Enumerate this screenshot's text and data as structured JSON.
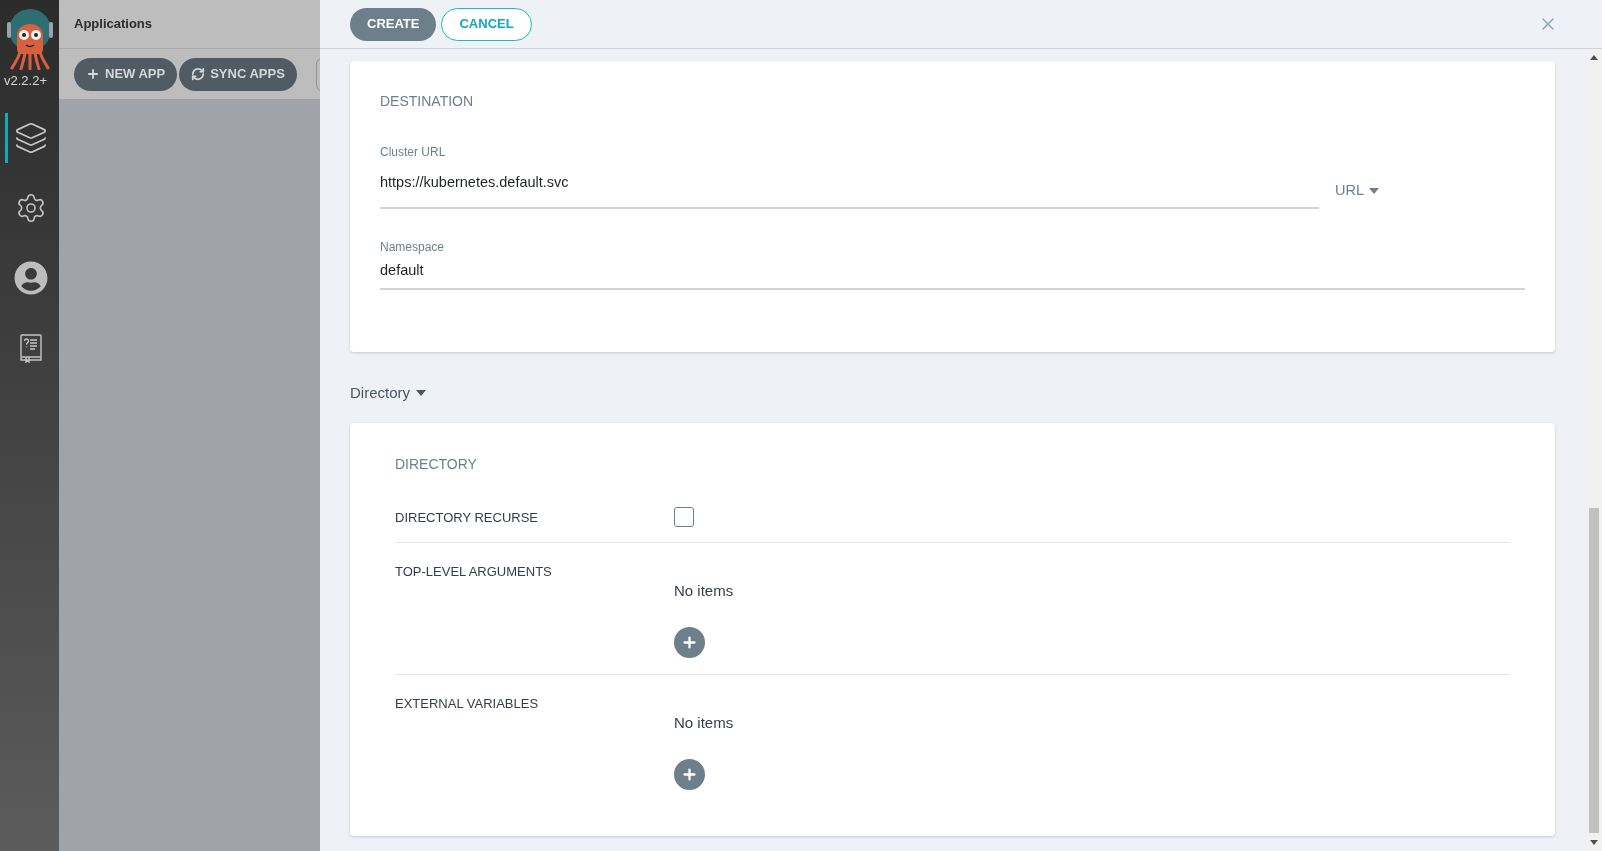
{
  "sidebar": {
    "version": "v2.2.2+",
    "items": [
      {
        "selected": true
      },
      {
        "selected": false
      },
      {
        "selected": false
      },
      {
        "selected": false
      }
    ]
  },
  "applications": {
    "title": "Applications",
    "toolbar": [
      {
        "label": "NEW APP",
        "kind": "plus"
      },
      {
        "label": "SYNC APPS",
        "kind": "sync"
      }
    ]
  },
  "panel": {
    "buttons": [
      {
        "label": "CREATE",
        "kind": "primary"
      },
      {
        "label": "CANCEL",
        "kind": "outline"
      }
    ]
  },
  "destination": {
    "title": "DESTINATION",
    "cluster_url": {
      "label": "Cluster URL",
      "value": "https://kubernetes.default.svc",
      "type_selector": "URL"
    },
    "namespace": {
      "label": "Namespace",
      "value": "default"
    }
  },
  "source_type": {
    "label": "Directory"
  },
  "directory": {
    "title": "DIRECTORY",
    "rows": [
      {
        "kind": "checkbox",
        "label": "DIRECTORY RECURSE",
        "checked": false
      },
      {
        "kind": "list",
        "label": "TOP-LEVEL ARGUMENTS",
        "empty_text": "No items"
      },
      {
        "kind": "list",
        "label": "EXTERNAL VARIABLES",
        "empty_text": "No items"
      }
    ]
  }
}
